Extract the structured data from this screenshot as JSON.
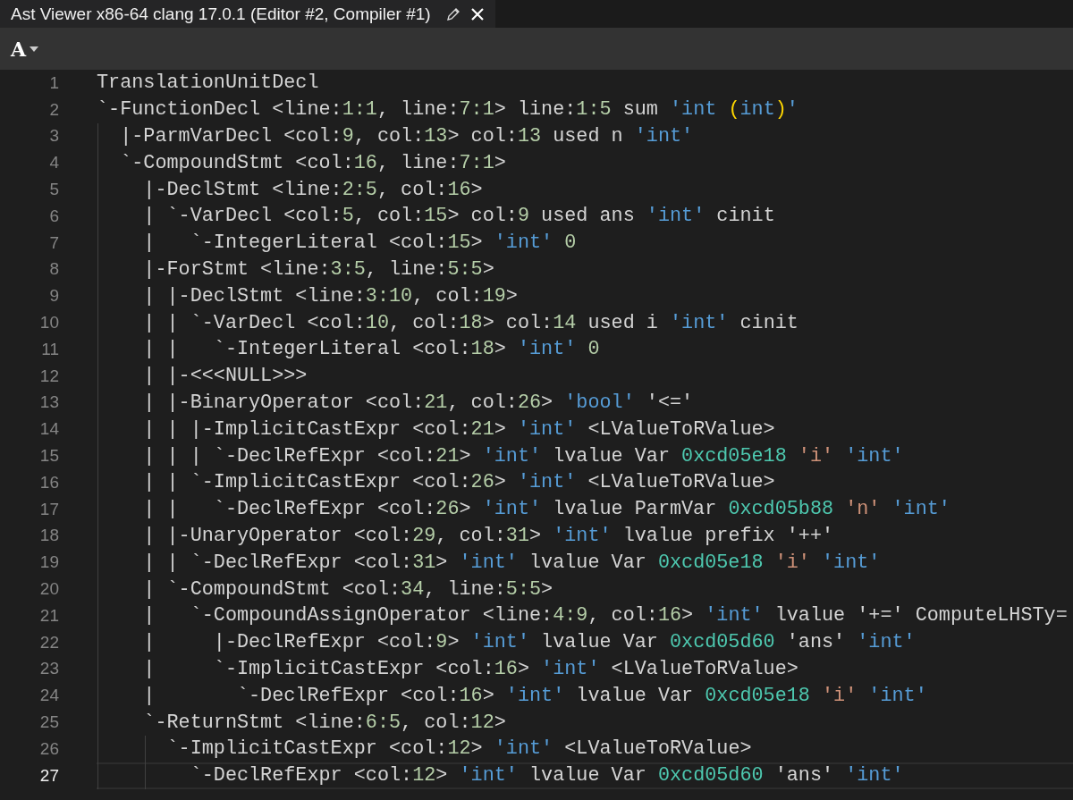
{
  "tab": {
    "title": "Ast Viewer x86-64 clang 17.0.1 (Editor #2, Compiler #1)"
  },
  "toolbar": {
    "font_button": "A"
  },
  "lines": [
    {
      "number": "1",
      "current": false,
      "tokens": [
        {
          "kind": "plain",
          "text": "TranslationUnitDecl"
        }
      ]
    },
    {
      "number": "2",
      "current": false,
      "tokens": [
        {
          "kind": "plain",
          "text": "`-FunctionDecl <line:"
        },
        {
          "kind": "number",
          "text": "1:1"
        },
        {
          "kind": "plain",
          "text": ", line:"
        },
        {
          "kind": "number",
          "text": "7:1"
        },
        {
          "kind": "plain",
          "text": "> line:"
        },
        {
          "kind": "number",
          "text": "1:5"
        },
        {
          "kind": "plain",
          "text": " sum "
        },
        {
          "kind": "type",
          "text": "'int "
        },
        {
          "kind": "paren",
          "text": "("
        },
        {
          "kind": "type",
          "text": "int"
        },
        {
          "kind": "paren",
          "text": ")"
        },
        {
          "kind": "type",
          "text": "'"
        }
      ]
    },
    {
      "number": "3",
      "current": false,
      "tokens": [
        {
          "kind": "plain",
          "text": "  |-ParmVarDecl <col:"
        },
        {
          "kind": "number",
          "text": "9"
        },
        {
          "kind": "plain",
          "text": ", col:"
        },
        {
          "kind": "number",
          "text": "13"
        },
        {
          "kind": "plain",
          "text": "> col:"
        },
        {
          "kind": "number",
          "text": "13"
        },
        {
          "kind": "plain",
          "text": " used n "
        },
        {
          "kind": "type",
          "text": "'int'"
        }
      ]
    },
    {
      "number": "4",
      "current": false,
      "tokens": [
        {
          "kind": "plain",
          "text": "  `-CompoundStmt <col:"
        },
        {
          "kind": "number",
          "text": "16"
        },
        {
          "kind": "plain",
          "text": ", line:"
        },
        {
          "kind": "number",
          "text": "7:1"
        },
        {
          "kind": "plain",
          "text": ">"
        }
      ]
    },
    {
      "number": "5",
      "current": false,
      "tokens": [
        {
          "kind": "plain",
          "text": "    |-DeclStmt <line:"
        },
        {
          "kind": "number",
          "text": "2:5"
        },
        {
          "kind": "plain",
          "text": ", col:"
        },
        {
          "kind": "number",
          "text": "16"
        },
        {
          "kind": "plain",
          "text": ">"
        }
      ]
    },
    {
      "number": "6",
      "current": false,
      "tokens": [
        {
          "kind": "plain",
          "text": "    | `-VarDecl <col:"
        },
        {
          "kind": "number",
          "text": "5"
        },
        {
          "kind": "plain",
          "text": ", col:"
        },
        {
          "kind": "number",
          "text": "15"
        },
        {
          "kind": "plain",
          "text": "> col:"
        },
        {
          "kind": "number",
          "text": "9"
        },
        {
          "kind": "plain",
          "text": " used ans "
        },
        {
          "kind": "type",
          "text": "'int'"
        },
        {
          "kind": "plain",
          "text": " cinit"
        }
      ]
    },
    {
      "number": "7",
      "current": false,
      "tokens": [
        {
          "kind": "plain",
          "text": "    |   `-IntegerLiteral <col:"
        },
        {
          "kind": "number",
          "text": "15"
        },
        {
          "kind": "plain",
          "text": "> "
        },
        {
          "kind": "type",
          "text": "'int'"
        },
        {
          "kind": "number",
          "text": " 0"
        }
      ]
    },
    {
      "number": "8",
      "current": false,
      "tokens": [
        {
          "kind": "plain",
          "text": "    |-ForStmt <line:"
        },
        {
          "kind": "number",
          "text": "3:5"
        },
        {
          "kind": "plain",
          "text": ", line:"
        },
        {
          "kind": "number",
          "text": "5:5"
        },
        {
          "kind": "plain",
          "text": ">"
        }
      ]
    },
    {
      "number": "9",
      "current": false,
      "tokens": [
        {
          "kind": "plain",
          "text": "    | |-DeclStmt <line:"
        },
        {
          "kind": "number",
          "text": "3:10"
        },
        {
          "kind": "plain",
          "text": ", col:"
        },
        {
          "kind": "number",
          "text": "19"
        },
        {
          "kind": "plain",
          "text": ">"
        }
      ]
    },
    {
      "number": "10",
      "current": false,
      "tokens": [
        {
          "kind": "plain",
          "text": "    | | `-VarDecl <col:"
        },
        {
          "kind": "number",
          "text": "10"
        },
        {
          "kind": "plain",
          "text": ", col:"
        },
        {
          "kind": "number",
          "text": "18"
        },
        {
          "kind": "plain",
          "text": "> col:"
        },
        {
          "kind": "number",
          "text": "14"
        },
        {
          "kind": "plain",
          "text": " used i "
        },
        {
          "kind": "type",
          "text": "'int'"
        },
        {
          "kind": "plain",
          "text": " cinit"
        }
      ]
    },
    {
      "number": "11",
      "current": false,
      "tokens": [
        {
          "kind": "plain",
          "text": "    | |   `-IntegerLiteral <col:"
        },
        {
          "kind": "number",
          "text": "18"
        },
        {
          "kind": "plain",
          "text": "> "
        },
        {
          "kind": "type",
          "text": "'int'"
        },
        {
          "kind": "number",
          "text": " 0"
        }
      ]
    },
    {
      "number": "12",
      "current": false,
      "tokens": [
        {
          "kind": "plain",
          "text": "    | |-<<<NULL>>>"
        }
      ]
    },
    {
      "number": "13",
      "current": false,
      "tokens": [
        {
          "kind": "plain",
          "text": "    | |-BinaryOperator <col:"
        },
        {
          "kind": "number",
          "text": "21"
        },
        {
          "kind": "plain",
          "text": ", col:"
        },
        {
          "kind": "number",
          "text": "26"
        },
        {
          "kind": "plain",
          "text": "> "
        },
        {
          "kind": "type",
          "text": "'bool'"
        },
        {
          "kind": "plain",
          "text": " '<='"
        }
      ]
    },
    {
      "number": "14",
      "current": false,
      "tokens": [
        {
          "kind": "plain",
          "text": "    | | |-ImplicitCastExpr <col:"
        },
        {
          "kind": "number",
          "text": "21"
        },
        {
          "kind": "plain",
          "text": "> "
        },
        {
          "kind": "type",
          "text": "'int'"
        },
        {
          "kind": "plain",
          "text": " <LValueToRValue>"
        }
      ]
    },
    {
      "number": "15",
      "current": false,
      "tokens": [
        {
          "kind": "plain",
          "text": "    | | | `-DeclRefExpr <col:"
        },
        {
          "kind": "number",
          "text": "21"
        },
        {
          "kind": "plain",
          "text": "> "
        },
        {
          "kind": "type",
          "text": "'int'"
        },
        {
          "kind": "plain",
          "text": " lvalue Var "
        },
        {
          "kind": "address",
          "text": "0xcd05e18"
        },
        {
          "kind": "name",
          "text": " 'i'"
        },
        {
          "kind": "type",
          "text": " 'int'"
        }
      ]
    },
    {
      "number": "16",
      "current": false,
      "tokens": [
        {
          "kind": "plain",
          "text": "    | | `-ImplicitCastExpr <col:"
        },
        {
          "kind": "number",
          "text": "26"
        },
        {
          "kind": "plain",
          "text": "> "
        },
        {
          "kind": "type",
          "text": "'int'"
        },
        {
          "kind": "plain",
          "text": " <LValueToRValue>"
        }
      ]
    },
    {
      "number": "17",
      "current": false,
      "tokens": [
        {
          "kind": "plain",
          "text": "    | |   `-DeclRefExpr <col:"
        },
        {
          "kind": "number",
          "text": "26"
        },
        {
          "kind": "plain",
          "text": "> "
        },
        {
          "kind": "type",
          "text": "'int'"
        },
        {
          "kind": "plain",
          "text": " lvalue ParmVar "
        },
        {
          "kind": "address",
          "text": "0xcd05b88"
        },
        {
          "kind": "name",
          "text": " 'n'"
        },
        {
          "kind": "type",
          "text": " 'int'"
        }
      ]
    },
    {
      "number": "18",
      "current": false,
      "tokens": [
        {
          "kind": "plain",
          "text": "    | |-UnaryOperator <col:"
        },
        {
          "kind": "number",
          "text": "29"
        },
        {
          "kind": "plain",
          "text": ", col:"
        },
        {
          "kind": "number",
          "text": "31"
        },
        {
          "kind": "plain",
          "text": "> "
        },
        {
          "kind": "type",
          "text": "'int'"
        },
        {
          "kind": "plain",
          "text": " lvalue prefix '++'"
        }
      ]
    },
    {
      "number": "19",
      "current": false,
      "tokens": [
        {
          "kind": "plain",
          "text": "    | | `-DeclRefExpr <col:"
        },
        {
          "kind": "number",
          "text": "31"
        },
        {
          "kind": "plain",
          "text": "> "
        },
        {
          "kind": "type",
          "text": "'int'"
        },
        {
          "kind": "plain",
          "text": " lvalue Var "
        },
        {
          "kind": "address",
          "text": "0xcd05e18"
        },
        {
          "kind": "name",
          "text": " 'i'"
        },
        {
          "kind": "type",
          "text": " 'int'"
        }
      ]
    },
    {
      "number": "20",
      "current": false,
      "tokens": [
        {
          "kind": "plain",
          "text": "    | `-CompoundStmt <col:"
        },
        {
          "kind": "number",
          "text": "34"
        },
        {
          "kind": "plain",
          "text": ", line:"
        },
        {
          "kind": "number",
          "text": "5:5"
        },
        {
          "kind": "plain",
          "text": ">"
        }
      ]
    },
    {
      "number": "21",
      "current": false,
      "tokens": [
        {
          "kind": "plain",
          "text": "    |   `-CompoundAssignOperator <line:"
        },
        {
          "kind": "number",
          "text": "4:9"
        },
        {
          "kind": "plain",
          "text": ", col:"
        },
        {
          "kind": "number",
          "text": "16"
        },
        {
          "kind": "plain",
          "text": "> "
        },
        {
          "kind": "type",
          "text": "'int'"
        },
        {
          "kind": "plain",
          "text": " lvalue '+=' ComputeLHSTy="
        }
      ]
    },
    {
      "number": "22",
      "current": false,
      "tokens": [
        {
          "kind": "plain",
          "text": "    |     |-DeclRefExpr <col:"
        },
        {
          "kind": "number",
          "text": "9"
        },
        {
          "kind": "plain",
          "text": "> "
        },
        {
          "kind": "type",
          "text": "'int'"
        },
        {
          "kind": "plain",
          "text": " lvalue Var "
        },
        {
          "kind": "address",
          "text": "0xcd05d60"
        },
        {
          "kind": "plain",
          "text": " 'ans' "
        },
        {
          "kind": "type",
          "text": "'int'"
        }
      ]
    },
    {
      "number": "23",
      "current": false,
      "tokens": [
        {
          "kind": "plain",
          "text": "    |     `-ImplicitCastExpr <col:"
        },
        {
          "kind": "number",
          "text": "16"
        },
        {
          "kind": "plain",
          "text": "> "
        },
        {
          "kind": "type",
          "text": "'int'"
        },
        {
          "kind": "plain",
          "text": " <LValueToRValue>"
        }
      ]
    },
    {
      "number": "24",
      "current": false,
      "tokens": [
        {
          "kind": "plain",
          "text": "    |       `-DeclRefExpr <col:"
        },
        {
          "kind": "number",
          "text": "16"
        },
        {
          "kind": "plain",
          "text": "> "
        },
        {
          "kind": "type",
          "text": "'int'"
        },
        {
          "kind": "plain",
          "text": " lvalue Var "
        },
        {
          "kind": "address",
          "text": "0xcd05e18"
        },
        {
          "kind": "name",
          "text": " 'i'"
        },
        {
          "kind": "type",
          "text": " 'int'"
        }
      ]
    },
    {
      "number": "25",
      "current": false,
      "tokens": [
        {
          "kind": "plain",
          "text": "    `-ReturnStmt <line:"
        },
        {
          "kind": "number",
          "text": "6:5"
        },
        {
          "kind": "plain",
          "text": ", col:"
        },
        {
          "kind": "number",
          "text": "12"
        },
        {
          "kind": "plain",
          "text": ">"
        }
      ]
    },
    {
      "number": "26",
      "current": false,
      "tokens": [
        {
          "kind": "plain",
          "text": "      `-ImplicitCastExpr <col:"
        },
        {
          "kind": "number",
          "text": "12"
        },
        {
          "kind": "plain",
          "text": "> "
        },
        {
          "kind": "type",
          "text": "'int'"
        },
        {
          "kind": "plain",
          "text": " <LValueToRValue>"
        }
      ]
    },
    {
      "number": "27",
      "current": true,
      "tokens": [
        {
          "kind": "plain",
          "text": "        `-DeclRefExpr <col:"
        },
        {
          "kind": "number",
          "text": "12"
        },
        {
          "kind": "plain",
          "text": "> "
        },
        {
          "kind": "type",
          "text": "'int'"
        },
        {
          "kind": "plain",
          "text": " lvalue Var "
        },
        {
          "kind": "address",
          "text": "0xcd05d60"
        },
        {
          "kind": "plain",
          "text": " 'ans' "
        },
        {
          "kind": "type",
          "text": "'int'"
        }
      ]
    }
  ]
}
